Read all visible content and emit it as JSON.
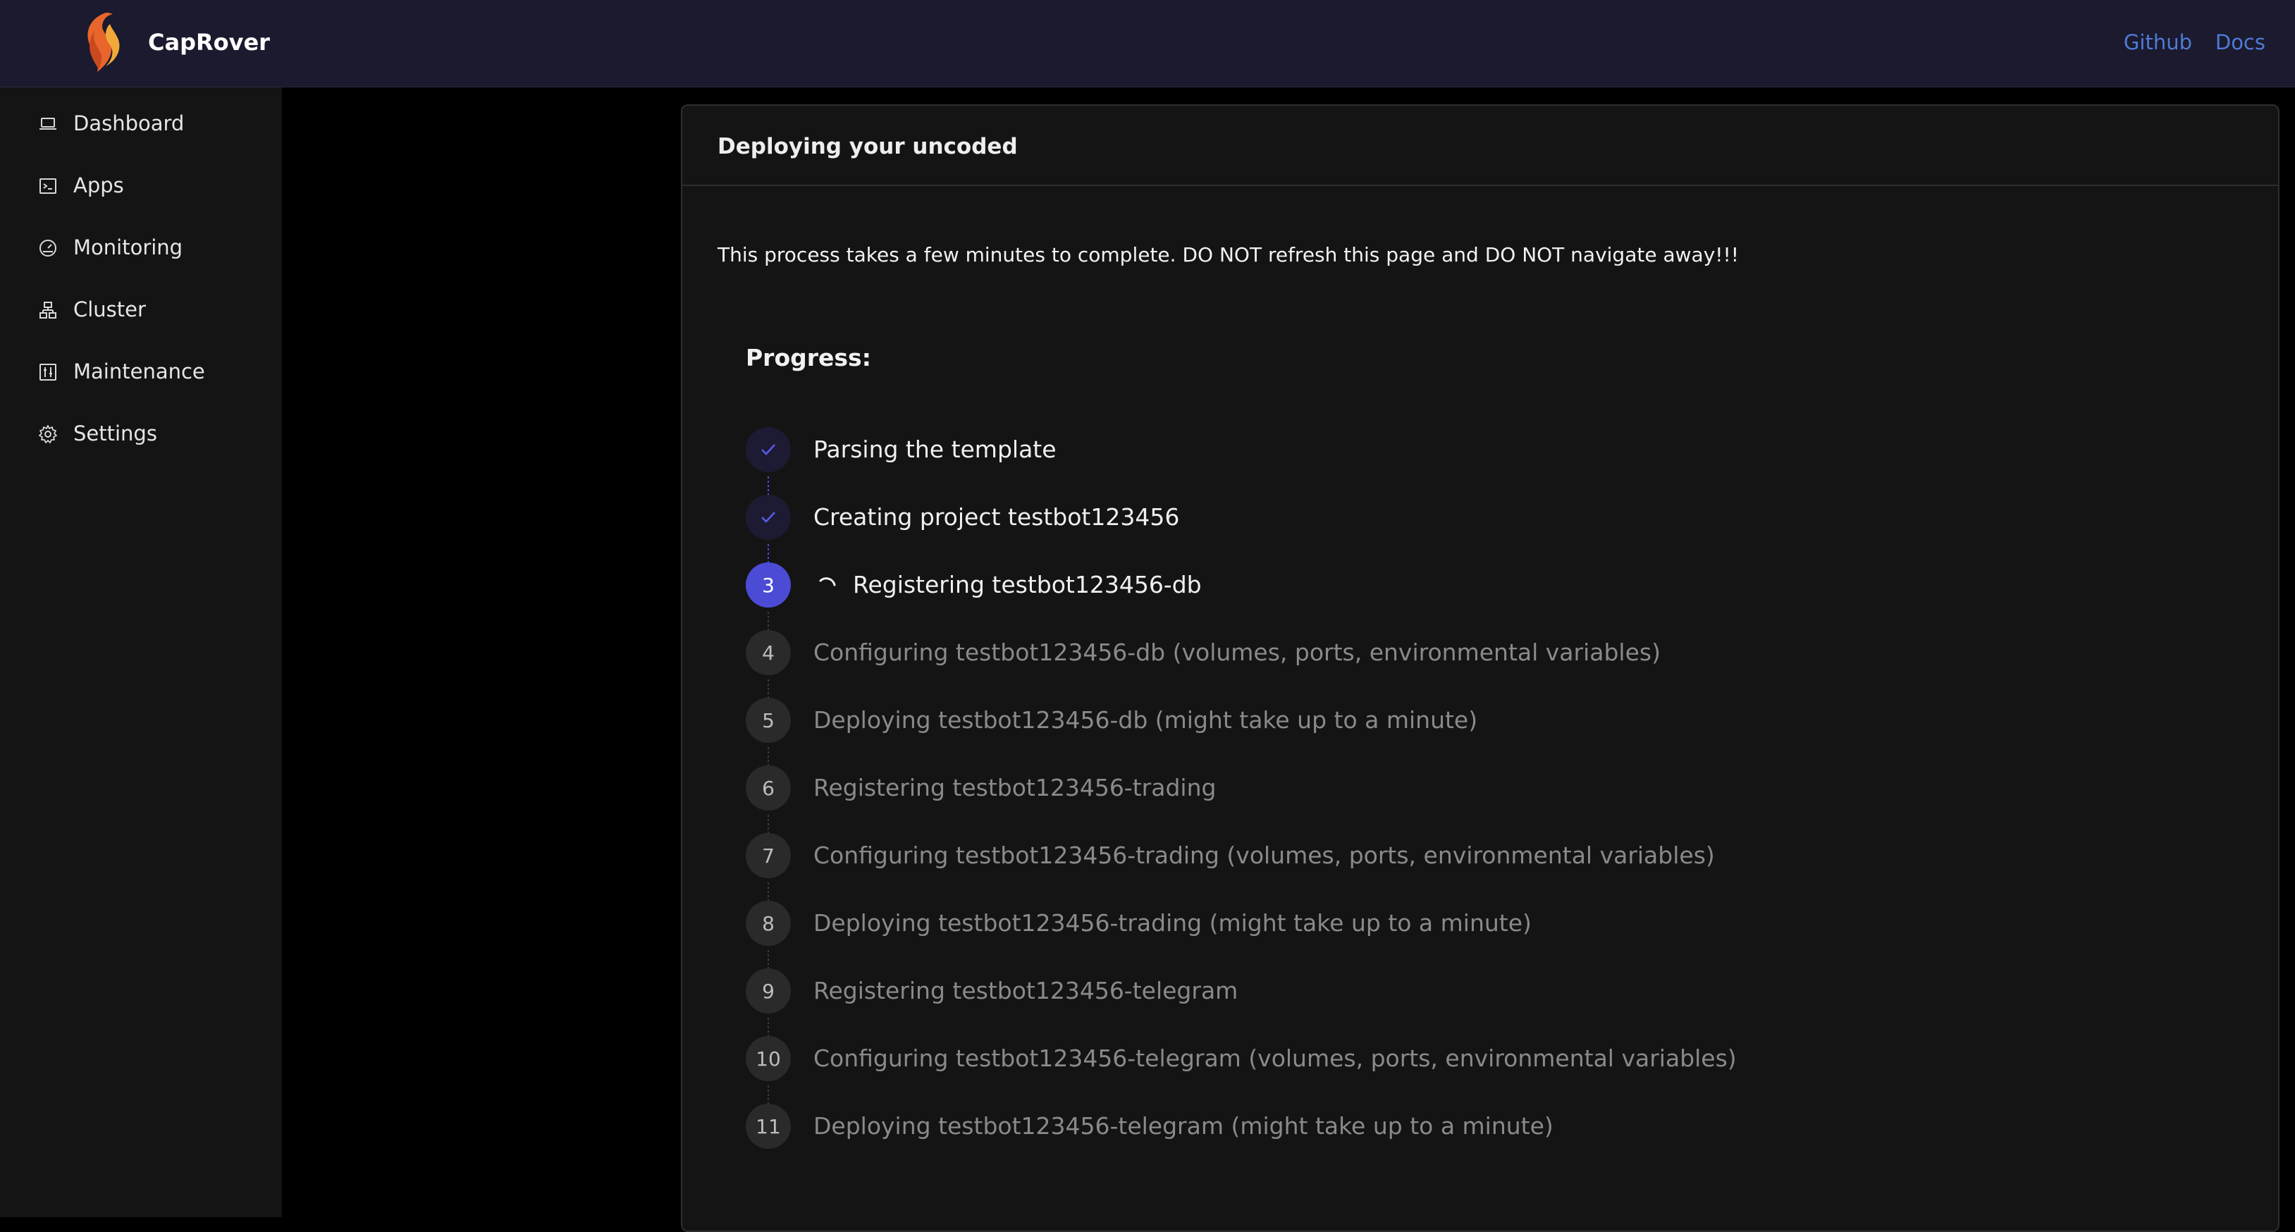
{
  "header": {
    "brand": "CapRover",
    "links": [
      {
        "label": "Github"
      },
      {
        "label": "Docs"
      }
    ]
  },
  "sidebar": {
    "items": [
      {
        "label": "Dashboard",
        "icon": "laptop-icon"
      },
      {
        "label": "Apps",
        "icon": "code-icon"
      },
      {
        "label": "Monitoring",
        "icon": "dashboard-gauge-icon"
      },
      {
        "label": "Cluster",
        "icon": "cluster-icon"
      },
      {
        "label": "Maintenance",
        "icon": "control-icon"
      },
      {
        "label": "Settings",
        "icon": "gear-icon"
      }
    ]
  },
  "main": {
    "title": "Deploying your uncoded",
    "warning": "This process takes a few minutes to complete. DO NOT refresh this page and DO NOT navigate away!!!",
    "progress_label": "Progress:",
    "steps": [
      {
        "number": "1",
        "status": "done",
        "text": "Parsing the template"
      },
      {
        "number": "2",
        "status": "done",
        "text": "Creating project testbot123456"
      },
      {
        "number": "3",
        "status": "active",
        "text": "Registering testbot123456-db"
      },
      {
        "number": "4",
        "status": "pending",
        "text": "Configuring testbot123456-db (volumes, ports, environmental variables)"
      },
      {
        "number": "5",
        "status": "pending",
        "text": "Deploying testbot123456-db (might take up to a minute)"
      },
      {
        "number": "6",
        "status": "pending",
        "text": "Registering testbot123456-trading"
      },
      {
        "number": "7",
        "status": "pending",
        "text": "Configuring testbot123456-trading (volumes, ports, environmental variables)"
      },
      {
        "number": "8",
        "status": "pending",
        "text": "Deploying testbot123456-trading (might take up to a minute)"
      },
      {
        "number": "9",
        "status": "pending",
        "text": "Registering testbot123456-telegram"
      },
      {
        "number": "10",
        "status": "pending",
        "text": "Configuring testbot123456-telegram (volumes, ports, environmental variables)"
      },
      {
        "number": "11",
        "status": "pending",
        "text": "Deploying testbot123456-telegram (might take up to a minute)"
      }
    ]
  },
  "colors": {
    "header_bg": "#1b1a2e",
    "sidebar_bg": "#141414",
    "accent": "#4b4bd6",
    "link": "#4f7ad6"
  }
}
